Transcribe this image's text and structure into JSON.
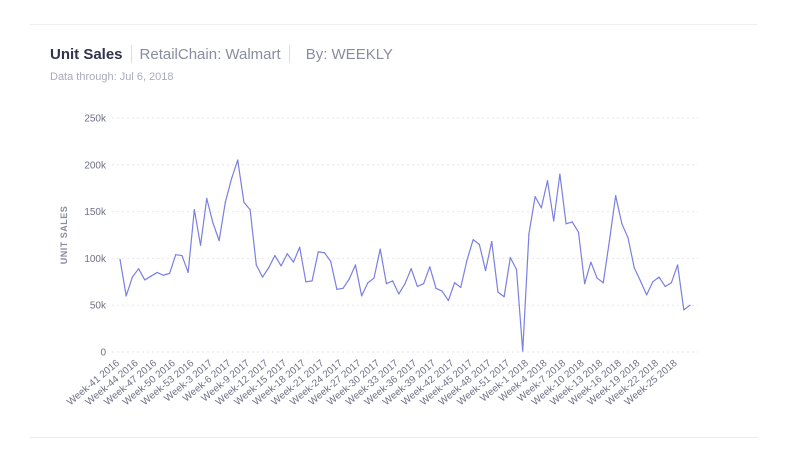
{
  "header": {
    "title": "Unit Sales",
    "filter_label": "RetailChain: Walmart",
    "groupby_label": "By: WEEKLY",
    "data_through": "Data through: Jul 6, 2018"
  },
  "colors": {
    "line": "#7b7fe0",
    "grid": "#e6e6ee",
    "title": "#33334d",
    "muted": "#8a8ca0"
  },
  "chart_data": {
    "type": "line",
    "title": "Unit Sales",
    "xlabel": "",
    "ylabel": "UNIT SALES",
    "ylim": [
      0,
      250000
    ],
    "yticks": [
      0,
      50000,
      100000,
      150000,
      200000,
      250000
    ],
    "ytick_labels": [
      "0",
      "50k",
      "100k",
      "150k",
      "200k",
      "250k"
    ],
    "grid": true,
    "legend": "none",
    "x_tick_labels": [
      "Week-41 2016",
      "Week-44 2016",
      "Week-47 2016",
      "Week-50 2016",
      "Week-53 2016",
      "Week-3 2017",
      "Week-6 2017",
      "Week-9 2017",
      "Week-12 2017",
      "Week-15 2017",
      "Week-18 2017",
      "Week-21 2017",
      "Week-24 2017",
      "Week-27 2017",
      "Week-30 2017",
      "Week-33 2017",
      "Week-36 2017",
      "Week-39 2017",
      "Week-42 2017",
      "Week-45 2017",
      "Week-48 2017",
      "Week-51 2017",
      "Week-1 2018",
      "Week-4 2018",
      "Week-7 2018",
      "Week-10 2018",
      "Week-13 2018",
      "Week-16 2018",
      "Week-19 2018",
      "Week-22 2018",
      "Week-25 2018"
    ],
    "series": [
      {
        "values": [
          99000,
          60000,
          80000,
          89000,
          77000,
          81000,
          85000,
          82000,
          84000,
          104000,
          103000,
          85000,
          152000,
          114000,
          164000,
          138000,
          119000,
          160000,
          185000,
          205000,
          160000,
          152000,
          93000,
          80000,
          90000,
          103000,
          92000,
          105000,
          96000,
          112000,
          75000,
          76000,
          107000,
          106000,
          97000,
          67000,
          68000,
          78000,
          93000,
          60000,
          74000,
          79000,
          110000,
          73000,
          76000,
          62000,
          73000,
          89000,
          70000,
          73000,
          91000,
          68000,
          65000,
          55000,
          74000,
          69000,
          98000,
          120000,
          115000,
          87000,
          118000,
          64000,
          59000,
          101000,
          88000,
          1000,
          126000,
          166000,
          154000,
          183000,
          140000,
          190000,
          137000,
          139000,
          128000,
          73000,
          96000,
          79000,
          74000,
          119000,
          167000,
          137000,
          122000,
          90000,
          76000,
          61000,
          75000,
          80000,
          70000,
          74000,
          93000,
          45000,
          50000
        ]
      }
    ]
  }
}
